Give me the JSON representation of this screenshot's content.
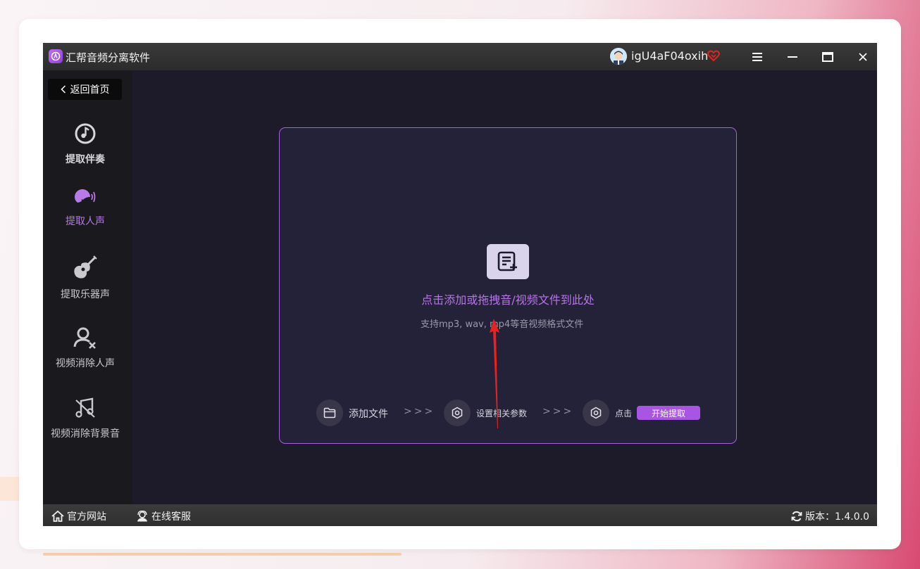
{
  "window": {
    "title": "汇帮音频分离软件",
    "user_name": "igU4aF04oxih",
    "icons": [
      "app-logo-icon",
      "avatar",
      "vip-heart-icon",
      "menu-icon",
      "minimize-icon",
      "maximize-icon",
      "close-icon"
    ]
  },
  "sidebar": {
    "back_label": "返回首页",
    "items": [
      {
        "label": "提取伴奏",
        "icon": "music-note-icon"
      },
      {
        "label": "提取人声",
        "icon": "voice-icon",
        "active": true
      },
      {
        "label": "提取乐器声",
        "icon": "guitar-icon"
      },
      {
        "label": "视频消除人声",
        "icon": "remove-person-icon"
      },
      {
        "label": "视频消除背景音",
        "icon": "mute-music-icon"
      }
    ]
  },
  "dropzone": {
    "title": "点击添加或拖拽音/视频文件到此处",
    "subtitle": "支持mp3, wav, mp4等音视频格式文件",
    "steps": {
      "step1": "添加文件",
      "arrows": ">>>",
      "step2": "设置相关参数",
      "step3": "点击",
      "start_button": "开始提取"
    }
  },
  "statusbar": {
    "website": "官方网站",
    "support": "在线客服",
    "version": "版本：1.4.0.0"
  },
  "colors": {
    "accent": "#a955e3",
    "accent_text": "#b774ea",
    "background": "#1d1b2a",
    "annotation_arrow": "#e8221e"
  }
}
